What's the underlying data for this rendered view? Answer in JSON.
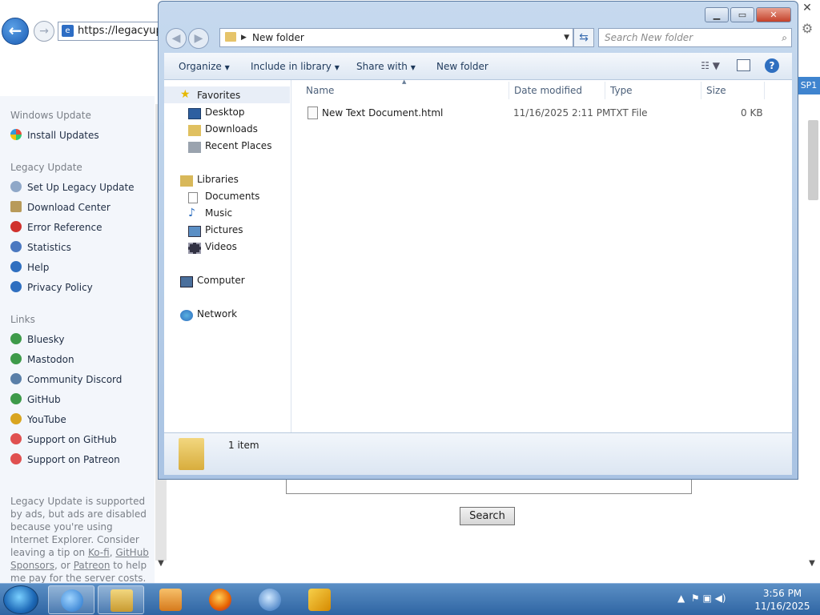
{
  "ie": {
    "address": "https://legacyupda",
    "sidebar": {
      "windows_update_heading": "Windows Update",
      "install_updates": "Install Updates",
      "legacy_update_heading": "Legacy Update",
      "items": [
        "Set Up Legacy Update",
        "Download Center",
        "Error Reference",
        "Statistics",
        "Help",
        "Privacy Policy"
      ],
      "links_heading": "Links",
      "links": [
        "Bluesky",
        "Mastodon",
        "Community Discord",
        "GitHub",
        "YouTube",
        "Support on GitHub",
        "Support on Patreon"
      ],
      "note_1": "Legacy Update is supported by ads, but ads are disabled because you're using Internet Explorer. Consider leaving a tip on ",
      "kofi": "Ko-fi",
      "sep1": ", ",
      "github_sponsors": "GitHub Sponsors",
      "sep2": ", or ",
      "patreon": "Patreon",
      "note_2": " to help me pay for the server costs. Thank you!"
    },
    "sp1_badge": "SP1",
    "search_button": "Search"
  },
  "explorer": {
    "path": "New folder",
    "search_placeholder": "Search New folder",
    "commands": {
      "organize": "Organize",
      "include_in_library": "Include in library",
      "share_with": "Share with",
      "new_folder": "New folder"
    },
    "nav": {
      "favorites": "Favorites",
      "desktop": "Desktop",
      "downloads": "Downloads",
      "recent_places": "Recent Places",
      "libraries": "Libraries",
      "documents": "Documents",
      "music": "Music",
      "pictures": "Pictures",
      "videos": "Videos",
      "computer": "Computer",
      "network": "Network"
    },
    "columns": {
      "name": "Name",
      "date_modified": "Date modified",
      "type": "Type",
      "size": "Size"
    },
    "files": [
      {
        "name": "New Text Document.html",
        "date": "11/16/2025 2:11 PM",
        "type": "TXT File",
        "size": "0 KB"
      }
    ],
    "status": "1 item"
  },
  "taskbar": {
    "time": "3:56 PM",
    "date": "11/16/2025"
  }
}
